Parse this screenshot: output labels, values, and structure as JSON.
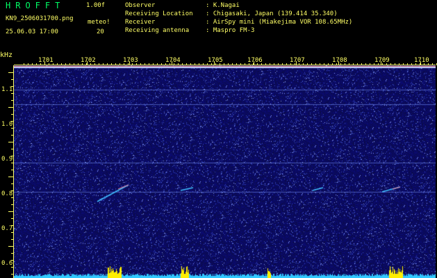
{
  "header": {
    "app_title": "HROFFT",
    "version": "1.00f",
    "file_name": "KN9_2506031700.png",
    "meteo_label": "meteo!",
    "meteo_value": "20",
    "datetime": "25.06.03 17:00"
  },
  "info": [
    {
      "label": "Observer",
      "value": ": K.Nagai"
    },
    {
      "label": "Receiving Location",
      "value": ": Chigasaki, Japan (139.414 35.340)"
    },
    {
      "label": "Receiver",
      "value": ": AirSpy mini (Miakejima VOR 108.65MHz)"
    },
    {
      "label": "Receiving antenna",
      "value": ": Maspro FM-3"
    }
  ],
  "axis": {
    "unit": "kHz",
    "y_ticks": [
      "1.1",
      "1.0",
      "0.9",
      "0.8",
      "0.7",
      "0.6"
    ],
    "x_ticks": [
      "1701",
      "1702",
      "1703",
      "1704",
      "1705",
      "1706",
      "1707",
      "1708",
      "1709",
      "1710"
    ]
  },
  "colors": {
    "label_text": "#ffff66",
    "title_text": "#00ff66",
    "tick_lines": "#ffff66",
    "background_noise": "#101060",
    "signal": "#40c0ff"
  }
}
